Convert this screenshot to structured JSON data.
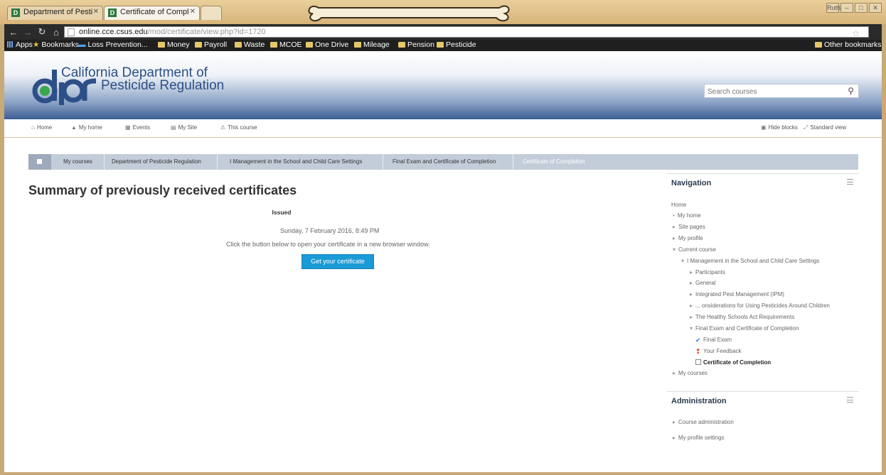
{
  "browser": {
    "tabs": [
      {
        "label": "Department of Pesti"
      },
      {
        "label": "Certificate of Compl"
      }
    ],
    "url_host": "online.cce.csus.edu",
    "url_path": "/mod/certificate/view.php?id=1720",
    "profile_label": "Ruth",
    "bookmarks": [
      {
        "label": "Apps"
      },
      {
        "label": "Bookmarks"
      },
      {
        "label": "Loss Prevention..."
      },
      {
        "label": "Money"
      },
      {
        "label": "Payroll"
      },
      {
        "label": "Waste"
      },
      {
        "label": "MCOE"
      },
      {
        "label": "One Drive"
      },
      {
        "label": "Mileage"
      },
      {
        "label": "Pension"
      },
      {
        "label": "Pesticide"
      },
      {
        "label": "Other bookmarks"
      }
    ]
  },
  "header": {
    "logo_text": "dpr",
    "brand_line1": "California Department of",
    "brand_line2": "Pesticide Regulation",
    "search_placeholder": "Search courses"
  },
  "menu": {
    "items": [
      {
        "label": "Home"
      },
      {
        "label": "My home"
      },
      {
        "label": "Events"
      },
      {
        "label": "My Site"
      },
      {
        "label": "This course"
      }
    ],
    "hide_blocks": "Hide blocks",
    "standard_view": "Standard view"
  },
  "breadcrumb": [
    {
      "label": "My courses"
    },
    {
      "label": "Department of Pesticide Regulation"
    },
    {
      "label": "I Management in the School and Child Care Settings"
    },
    {
      "label": "Final Exam and Certificate of Completion"
    },
    {
      "label": "Certificate of Completion"
    }
  ],
  "main": {
    "title": "Summary of previously received certificates",
    "issued_header": "Issued",
    "issued_value": "Sunday, 7 February 2016, 8:49 PM",
    "instruction": "Click the button below to open your certificate in a new browser window.",
    "button_label": "Get your certificate"
  },
  "navigation": {
    "title": "Navigation",
    "items": [
      {
        "label": "Home"
      },
      {
        "label": "My home"
      },
      {
        "label": "Site pages"
      },
      {
        "label": "My profile"
      },
      {
        "label": "Current course"
      },
      {
        "label": "I Management in the School and Child Care Settings"
      },
      {
        "label": "Participants"
      },
      {
        "label": "General"
      },
      {
        "label": "Integrated Pest Management (IPM)"
      },
      {
        "label": "... onsiderations for Using Pesticides Around Children"
      },
      {
        "label": "The Healthy Schools Act Requirements"
      },
      {
        "label": "Final Exam and Certificate of Completion"
      },
      {
        "label": "Final Exam"
      },
      {
        "label": "Your Feedback"
      },
      {
        "label": "Certificate of Completion"
      },
      {
        "label": "My courses"
      }
    ]
  },
  "administration": {
    "title": "Administration",
    "items": [
      {
        "label": "Course administration"
      },
      {
        "label": "My profile settings"
      }
    ]
  },
  "colors": {
    "accent_button": "#1a9ad6",
    "header_blue": "#3d5f94",
    "brand_text": "#2d4f87",
    "logo_green": "#3aa64a"
  }
}
